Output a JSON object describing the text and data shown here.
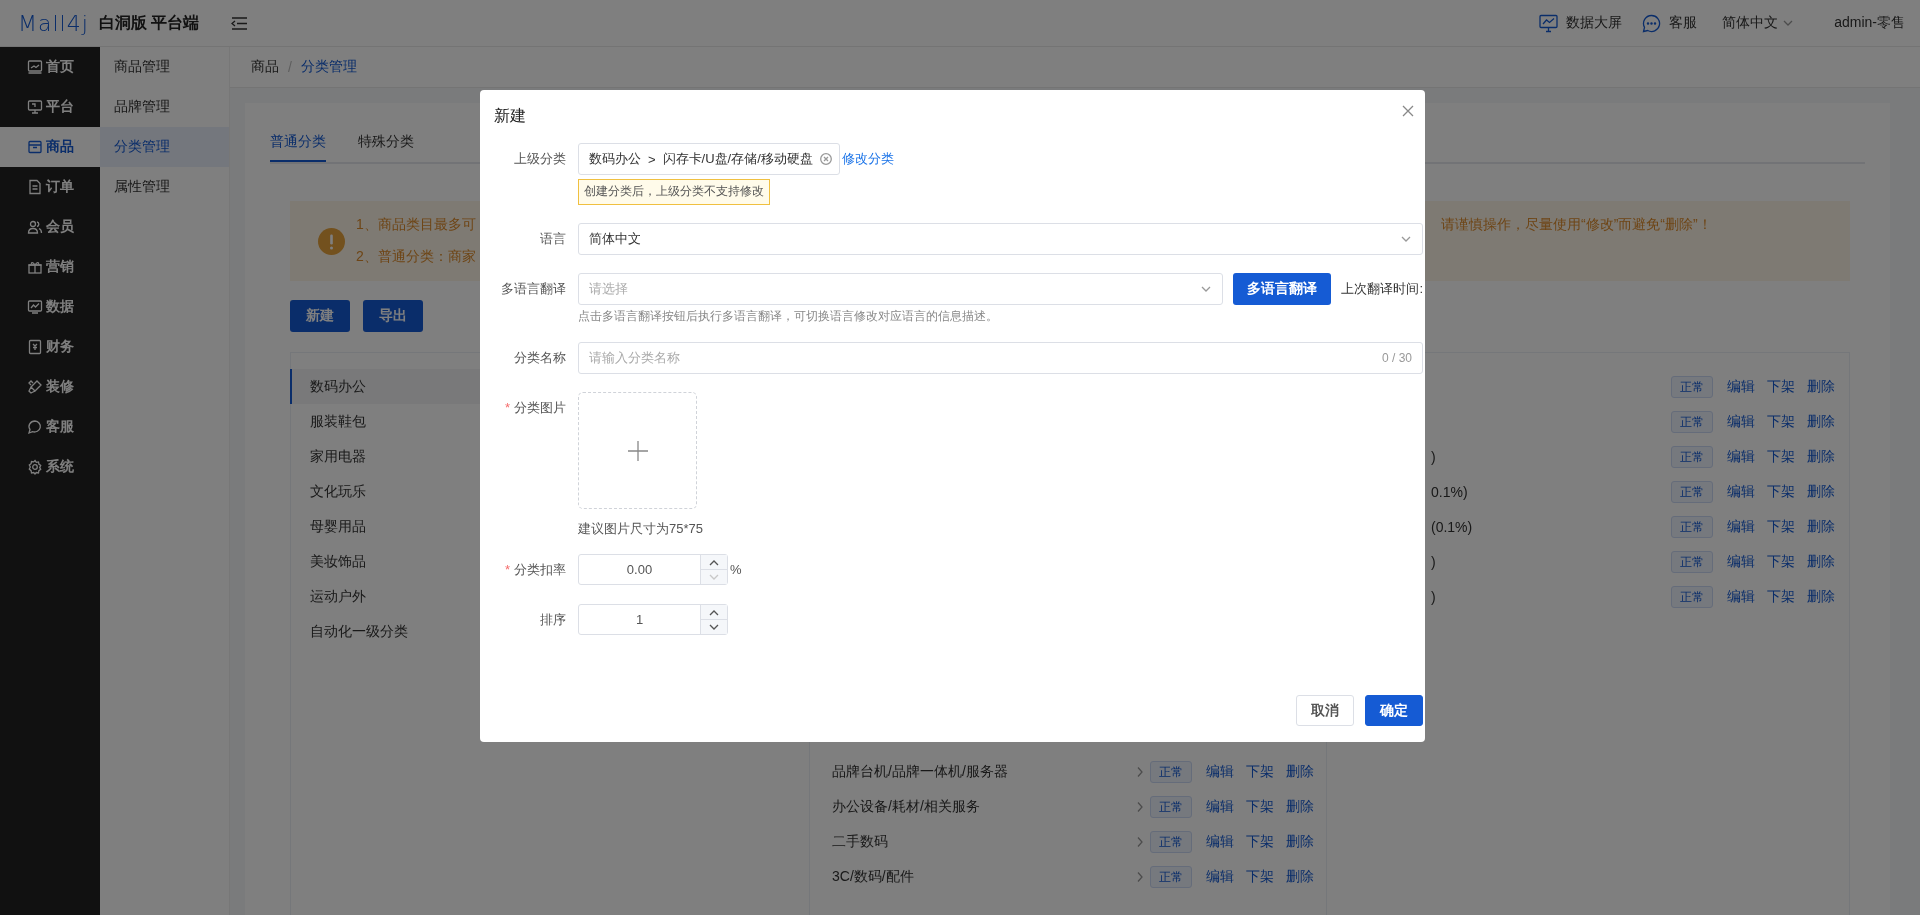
{
  "header": {
    "logo": "Mall4j",
    "title": "白洞版 平台端",
    "actions": [
      {
        "kind": "screen",
        "label": "数据大屏"
      },
      {
        "kind": "chat",
        "label": "客服"
      }
    ],
    "language": "简体中文",
    "user": "admin-零售"
  },
  "sidebar": {
    "items": [
      {
        "label": "首页",
        "kind": "home",
        "selected": false
      },
      {
        "label": "平台",
        "kind": "platform",
        "selected": false
      },
      {
        "label": "商品",
        "kind": "goods",
        "selected": true
      },
      {
        "label": "订单",
        "kind": "order",
        "selected": false
      },
      {
        "label": "会员",
        "kind": "member",
        "selected": false
      },
      {
        "label": "营销",
        "kind": "marketing",
        "selected": false
      },
      {
        "label": "数据",
        "kind": "data",
        "selected": false
      },
      {
        "label": "财务",
        "kind": "finance",
        "selected": false
      },
      {
        "label": "装修",
        "kind": "decor",
        "selected": false
      },
      {
        "label": "客服",
        "kind": "service",
        "selected": false
      },
      {
        "label": "系统",
        "kind": "system",
        "selected": false
      }
    ]
  },
  "submenu": {
    "items": [
      {
        "label": "商品管理",
        "selected": false
      },
      {
        "label": "品牌管理",
        "selected": false
      },
      {
        "label": "分类管理",
        "selected": true
      },
      {
        "label": "属性管理",
        "selected": false
      }
    ]
  },
  "breadcrumb": {
    "items": [
      "商品",
      "分类管理"
    ],
    "separator": "/"
  },
  "tabs": [
    {
      "label": "普通分类",
      "selected": true
    },
    {
      "label": "特殊分类",
      "selected": false
    }
  ],
  "notice": {
    "lines": [
      {
        "start": "1、商品类目最多可",
        "end": "请谨慎操作，尽量使用“修改”而避免“删除”！"
      },
      {
        "start": "2、普通分类：商家"
      }
    ]
  },
  "toolbar": {
    "buttons": [
      "新建",
      "导出"
    ]
  },
  "categories": {
    "level1": [
      {
        "name": "数码办公",
        "selected": true
      },
      {
        "name": "服装鞋包",
        "selected": false
      },
      {
        "name": "家用电器",
        "selected": false
      },
      {
        "name": "文化玩乐",
        "selected": false
      },
      {
        "name": "母婴用品",
        "selected": false
      },
      {
        "name": "美妆饰品",
        "selected": false
      },
      {
        "name": "运动户外",
        "selected": false
      },
      {
        "name": "自动化一级分类",
        "selected": false
      }
    ],
    "level2": [
      {
        "name": "品牌台机/品牌一体机/服务器",
        "status": "正常",
        "actions": [
          "编辑",
          "下架",
          "删除"
        ]
      },
      {
        "name": "办公设备/耗材/相关服务",
        "status": "正常",
        "actions": [
          "编辑",
          "下架",
          "删除"
        ]
      },
      {
        "name": "二手数码",
        "status": "正常",
        "actions": [
          "编辑",
          "下架",
          "删除"
        ]
      },
      {
        "name": "3C/数码/配件",
        "status": "正常",
        "actions": [
          "编辑",
          "下架",
          "删除"
        ]
      }
    ],
    "level3": [
      {
        "status": "正常",
        "actions": [
          "编辑",
          "下架",
          "删除"
        ]
      },
      {
        "status": "正常",
        "actions": [
          "编辑",
          "下架",
          "删除"
        ]
      },
      {
        "name": ")",
        "status": "正常",
        "actions": [
          "编辑",
          "下架",
          "删除"
        ]
      },
      {
        "name": "0.1%)",
        "status": "正常",
        "actions": [
          "编辑",
          "下架",
          "删除"
        ]
      },
      {
        "name": "(0.1%)",
        "status": "正常",
        "actions": [
          "编辑",
          "下架",
          "删除"
        ]
      },
      {
        "name": ")",
        "status": "正常",
        "actions": [
          "编辑",
          "下架",
          "删除"
        ]
      },
      {
        "name": ")",
        "status": "正常",
        "actions": [
          "编辑",
          "下架",
          "删除"
        ]
      }
    ]
  },
  "dialog": {
    "title": "新建",
    "fields": [
      {
        "kind": "cascader",
        "label": "上级分类",
        "path": [
          "数码办公",
          "闪存卡/U盘/存储/移动硬盘"
        ],
        "separator": ">",
        "link": "修改分类",
        "tip": "创建分类后，上级分类不支持修改"
      },
      {
        "kind": "select",
        "label": "语言",
        "value": "简体中文"
      },
      {
        "kind": "translate",
        "label": "多语言翻译",
        "placeholder": "请选择",
        "button": "多语言翻译",
        "note": "上次翻译时间:",
        "hint": "点击多语言翻译按钮后执行多语言翻译，可切换语言修改对应语言的信息描述。"
      },
      {
        "kind": "text",
        "label": "分类名称",
        "placeholder": "请输入分类名称",
        "counter": "0 / 30"
      },
      {
        "kind": "upload",
        "label": "分类图片",
        "mark": "*",
        "hint": "建议图片尺寸为75*75"
      },
      {
        "kind": "number",
        "label": "分类扣率",
        "mark": "*",
        "value": "0.00",
        "suffix": "%",
        "decrease_disabled": true
      },
      {
        "kind": "number",
        "label": "排序",
        "value": "1",
        "decrease_disabled": false
      }
    ],
    "buttons": [
      {
        "kind": "default",
        "label": "取消"
      },
      {
        "kind": "primary",
        "label": "确定"
      }
    ]
  }
}
